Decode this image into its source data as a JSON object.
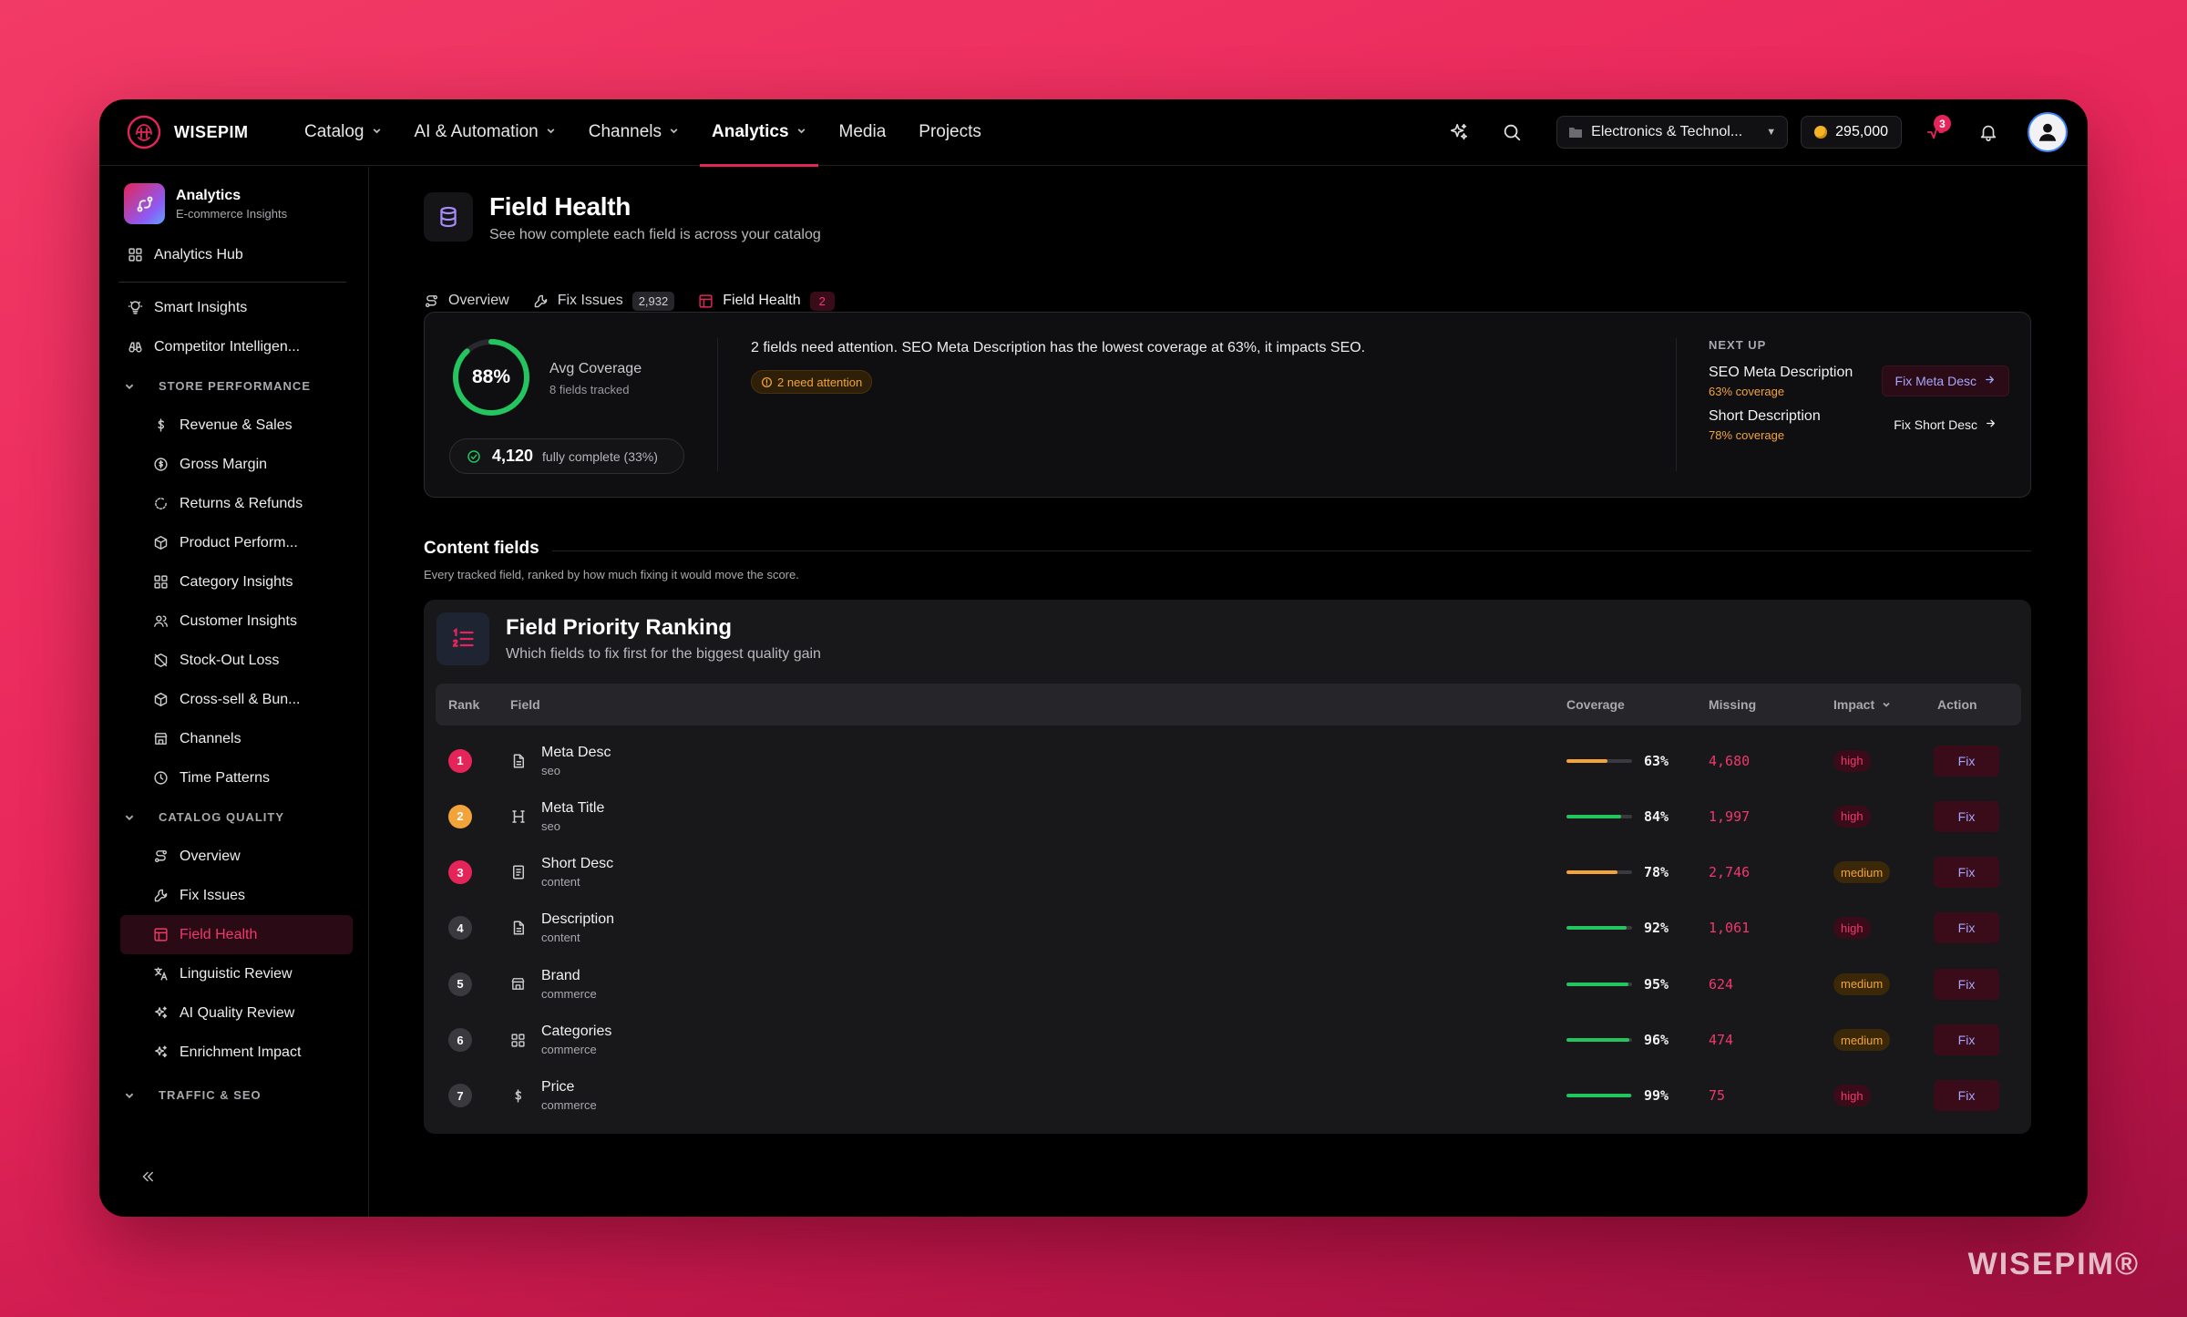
{
  "app": {
    "brand": "WISEPIM",
    "watermark": "WISEPIM®"
  },
  "topnav": {
    "items": [
      {
        "label": "Catalog",
        "dropdown": true
      },
      {
        "label": "AI & Automation",
        "dropdown": true
      },
      {
        "label": "Channels",
        "dropdown": true
      },
      {
        "label": "Analytics",
        "dropdown": true,
        "active": true
      },
      {
        "label": "Media",
        "dropdown": false
      },
      {
        "label": "Projects",
        "dropdown": false
      }
    ],
    "workspace": "Electronics & Technol...",
    "credits": "295,000",
    "activity_badge": "3"
  },
  "sidebar": {
    "title": "Analytics",
    "subtitle": "E-commerce Insights",
    "hub": "Analytics Hub",
    "top_items": [
      {
        "label": "Smart Insights",
        "icon": "lightbulb-icon"
      },
      {
        "label": "Competitor Intelligen...",
        "icon": "binoculars-icon"
      }
    ],
    "sections": [
      {
        "label": "STORE PERFORMANCE",
        "items": [
          {
            "label": "Revenue & Sales",
            "icon": "dollar-icon"
          },
          {
            "label": "Gross Margin",
            "icon": "coin-icon"
          },
          {
            "label": "Returns & Refunds",
            "icon": "refresh-icon"
          },
          {
            "label": "Product Perform...",
            "icon": "box-icon"
          },
          {
            "label": "Category Insights",
            "icon": "grid-icon"
          },
          {
            "label": "Customer Insights",
            "icon": "users-icon"
          },
          {
            "label": "Stock-Out Loss",
            "icon": "package-off-icon"
          },
          {
            "label": "Cross-sell & Bun...",
            "icon": "box-icon"
          },
          {
            "label": "Channels",
            "icon": "store-icon"
          },
          {
            "label": "Time Patterns",
            "icon": "clock-icon"
          }
        ]
      },
      {
        "label": "CATALOG QUALITY",
        "items": [
          {
            "label": "Overview",
            "icon": "route-icon"
          },
          {
            "label": "Fix Issues",
            "icon": "wrench-icon"
          },
          {
            "label": "Field Health",
            "icon": "table-icon",
            "active": true
          },
          {
            "label": "Linguistic Review",
            "icon": "translate-icon"
          },
          {
            "label": "AI Quality Review",
            "icon": "sparkles-icon"
          },
          {
            "label": "Enrichment Impact",
            "icon": "sparkles-icon"
          }
        ]
      },
      {
        "label": "TRAFFIC & SEO",
        "items": []
      }
    ]
  },
  "page": {
    "title": "Field Health",
    "subtitle": "See how complete each field is across your catalog",
    "tabs": [
      {
        "label": "Overview",
        "count": "",
        "icon": "route-icon"
      },
      {
        "label": "Fix Issues",
        "count": "2,932",
        "icon": "wrench-icon"
      },
      {
        "label": "Field Health",
        "count": "2",
        "icon": "table-icon",
        "active": true
      }
    ]
  },
  "summary": {
    "avg_coverage_pct": "88%",
    "avg_coverage_value": 0.88,
    "avg_label": "Avg Coverage",
    "fields_tracked": "8 fields tracked",
    "complete_count": "4,120",
    "complete_label": "fully complete (33%)",
    "message": "2 fields need attention. SEO Meta Description has the lowest coverage at 63%, it impacts SEO.",
    "attention_pill": "2 need attention",
    "next_up_label": "NEXT UP",
    "next_up": [
      {
        "name": "SEO Meta Description",
        "coverage": "63% coverage",
        "button": "Fix Meta Desc",
        "primary": true
      },
      {
        "name": "Short Description",
        "coverage": "78% coverage",
        "button": "Fix Short Desc",
        "primary": false
      }
    ]
  },
  "content_fields": {
    "title": "Content fields",
    "subtitle": "Every tracked field, ranked by how much fixing it would move the score."
  },
  "ranking": {
    "title": "Field Priority Ranking",
    "subtitle": "Which fields to fix first for the biggest quality gain",
    "columns": {
      "rank": "Rank",
      "field": "Field",
      "coverage": "Coverage",
      "missing": "Missing",
      "impact": "Impact",
      "action": "Action"
    },
    "rows": [
      {
        "rank": "1",
        "rank_color": "#e5245a",
        "name": "Meta Desc",
        "category": "seo",
        "icon": "document-icon",
        "coverage": "63%",
        "coverage_value": 0.63,
        "bar_color": "#f2a33a",
        "missing": "4,680",
        "impact": "high",
        "action": "Fix"
      },
      {
        "rank": "2",
        "rank_color": "#f2a33a",
        "name": "Meta Title",
        "category": "seo",
        "icon": "heading-icon",
        "coverage": "84%",
        "coverage_value": 0.84,
        "bar_color": "#22c55e",
        "missing": "1,997",
        "impact": "high",
        "action": "Fix"
      },
      {
        "rank": "3",
        "rank_color": "#e5245a",
        "name": "Short Desc",
        "category": "content",
        "icon": "text-doc-icon",
        "coverage": "78%",
        "coverage_value": 0.78,
        "bar_color": "#f2a33a",
        "missing": "2,746",
        "impact": "medium",
        "action": "Fix"
      },
      {
        "rank": "4",
        "rank_color": "#3a3a3e",
        "name": "Description",
        "category": "content",
        "icon": "document-icon",
        "coverage": "92%",
        "coverage_value": 0.92,
        "bar_color": "#22c55e",
        "missing": "1,061",
        "impact": "high",
        "action": "Fix"
      },
      {
        "rank": "5",
        "rank_color": "#3a3a3e",
        "name": "Brand",
        "category": "commerce",
        "icon": "store-icon",
        "coverage": "95%",
        "coverage_value": 0.95,
        "bar_color": "#22c55e",
        "missing": "624",
        "impact": "medium",
        "action": "Fix"
      },
      {
        "rank": "6",
        "rank_color": "#3a3a3e",
        "name": "Categories",
        "category": "commerce",
        "icon": "grid-icon",
        "coverage": "96%",
        "coverage_value": 0.96,
        "bar_color": "#22c55e",
        "missing": "474",
        "impact": "medium",
        "action": "Fix"
      },
      {
        "rank": "7",
        "rank_color": "#3a3a3e",
        "name": "Price",
        "category": "commerce",
        "icon": "dollar-icon",
        "coverage": "99%",
        "coverage_value": 0.99,
        "bar_color": "#22c55e",
        "missing": "75",
        "impact": "high",
        "action": "Fix"
      }
    ]
  },
  "colors": {
    "accent": "#e5245a",
    "success": "#22c55e",
    "warning": "#f2a33a",
    "link": "#a5a6ff"
  }
}
